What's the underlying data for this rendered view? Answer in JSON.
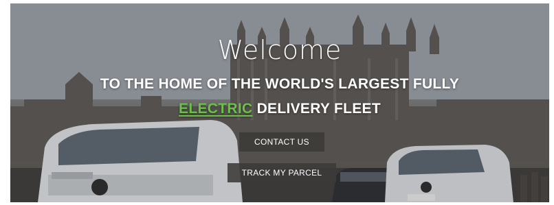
{
  "hero": {
    "welcome": "Welcome",
    "headline_line1": "TO THE HOME OF THE WORLD'S LARGEST FULLY",
    "headline_highlight": "ELECTRIC",
    "headline_line2_rest": " DELIVERY FLEET"
  },
  "buttons": {
    "contact": "CONTACT US",
    "track": "TRACK MY PARCEL"
  },
  "colors": {
    "accent_green": "#6cc04a",
    "button_bg": "#3c3a38",
    "text": "#ffffff"
  }
}
